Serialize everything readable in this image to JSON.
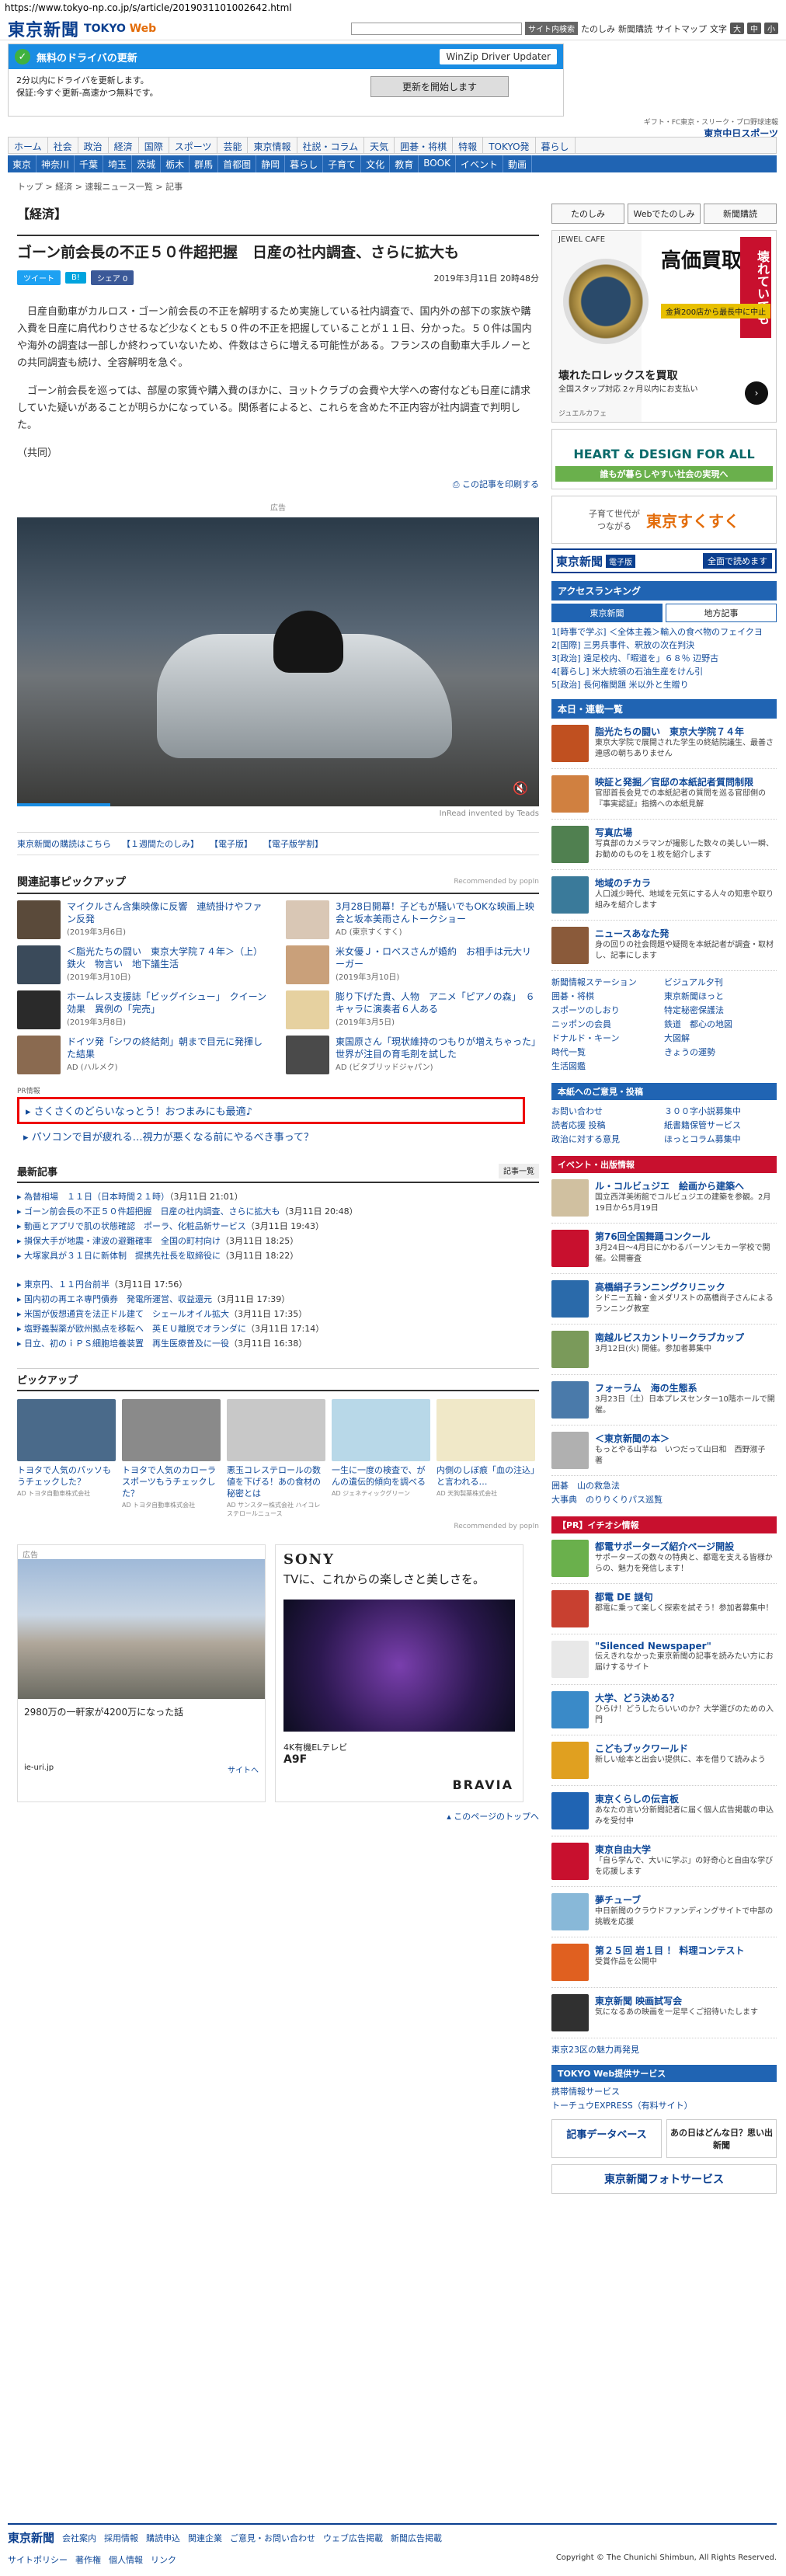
{
  "url": "https://www.tokyo-np.co.jp/s/article/2019031101002642.html",
  "header": {
    "logo": "東京新聞",
    "sub_left": "TOKYO ",
    "sub_right": "Web",
    "search_btn": "サイト内検索",
    "links": [
      "たのしみ",
      "新聞購読",
      "サイトマップ"
    ],
    "font_label": "文字",
    "font_btns": [
      "大",
      "中",
      "小"
    ]
  },
  "ad_top": {
    "title": "無料のドライバの更新",
    "winzip": "WinZip Driver Updater",
    "line1": "2分以内にドライバを更新します。",
    "line2": "保証:今すぐ更新-高速かつ無料です。",
    "button": "更新を開始します"
  },
  "rbanner": {
    "l1": "ギフト・FC東京・スリーク・プロ野球速報",
    "l2": "東京中日スポーツ"
  },
  "nav1": [
    "ホーム",
    "社会",
    "政治",
    "経済",
    "国際",
    "スポーツ",
    "芸能",
    "東京情報",
    "社説・コラム",
    "天気",
    "囲碁・将棋",
    "特報",
    "TOKYO発",
    "暮らし"
  ],
  "nav2": [
    "東京",
    "神奈川",
    "千葉",
    "埼玉",
    "茨城",
    "栃木",
    "群馬",
    "首都圏",
    "静岡",
    "暮らし",
    "子育て",
    "文化",
    "教育",
    "BOOK",
    "イベント",
    "動画"
  ],
  "breadcrumb": "トップ > 経済 > 速報ニュース一覧 > 記事",
  "article": {
    "section": "【経済】",
    "title": "ゴーン前会長の不正５０件超把握　日産の社内調査、さらに拡大も",
    "share": [
      "ツイート",
      "B!",
      "シェア 0"
    ],
    "date": "2019年3月11日 20時48分",
    "p1": "日産自動車がカルロス・ゴーン前会長の不正を解明するため実施している社内調査で、国内外の部下の家族や購入費を日産に肩代わりさせるなど少なくとも５０件の不正を把握していることが１１日、分かった。５０件は国内や海外の調査は一部しか終わっていないため、件数はさらに増える可能性がある。フランスの自動車大手ルノーとの共同調査も続け、全容解明を急ぐ。",
    "p2": "ゴーン前会長を巡っては、部屋の家賃や購入費のほかに、ヨットクラブの会費や大学への寄付なども日産に請求していた疑いがあることが明らかになっている。関係者によると、これらを含めた不正内容が社内調査で判明した。",
    "credit": "（共同）",
    "print": "この記事を印刷する"
  },
  "ad_video": {
    "label": "広告",
    "inread": "InRead invented by Teads"
  },
  "links_row": [
    "東京新聞の購読はこちら",
    "【１週間たのしみ】",
    "【電子版】",
    "【電子版学割】"
  ],
  "related": {
    "title": "関連記事ピックアップ",
    "rec": "Recommended by popIn",
    "items": [
      {
        "t": "マイクルさん含集映像に反響　連続掛けやファン反発",
        "s": "(2019年3月6日)"
      },
      {
        "t": "3月28日開幕！子どもが騒いでもOKな映画上映会と坂本美雨さんトークショー",
        "s": "AD (東京すくすく)"
      },
      {
        "t": "＜脂光たちの闘い　東京大学院７４年＞（上）鉄火　物言い　地下議生活",
        "s": "(2019年3月10日)"
      },
      {
        "t": "米女優Ｊ・ロペスさんが婚約　お相手は元大リーガー",
        "s": "(2019年3月10日)"
      },
      {
        "t": "ホームレス支援誌「ビッグイシュー」　クイーン効果　異例の「完売」",
        "s": "(2019年3月8日)"
      },
      {
        "t": "膨り下げた貴、人物　アニメ「ピアノの森」　６キャラに演奏者６人ある",
        "s": "(2019年3月5日)"
      },
      {
        "t": "ドイツ発「シワの終結剤」朝まで目元に発揮した結果",
        "s": "AD (ハルメク)"
      },
      {
        "t": "東国原さん「現状維持のつもりが増えちゃった」世界が注目の育毛剤を試した",
        "s": "AD (ビタブリッドジャパン)"
      }
    ]
  },
  "pr": {
    "label": "PR情報",
    "l1": "さくさくのどらいなっとう！おつまみにも最適♪",
    "l2": "パソコンで目が疲れる…視力が悪くなる前にやるべき事って？"
  },
  "latest": {
    "title": "最新記事",
    "more": "記事一覧",
    "g1": [
      {
        "t": "為替相場　１１日（日本時間２１時）",
        "d": "（3月11日 21:01）"
      },
      {
        "t": "ゴーン前会長の不正５０件超把握　日産の社内調査、さらに拡大も",
        "d": "（3月11日 20:48）"
      },
      {
        "t": "動画とアプリで肌の状態確認　ポーラ、化粧品新サービス",
        "d": "（3月11日 19:43）"
      },
      {
        "t": "損保大手が地震・津波の避難確率　全国の町村向け",
        "d": "（3月11日 18:25）"
      },
      {
        "t": "大塚家具が３１日に新体制　提携先社長を取締役に",
        "d": "（3月11日 18:22）"
      }
    ],
    "g2": [
      {
        "t": "東京円、１１円台前半",
        "d": "（3月11日 17:56）"
      },
      {
        "t": "国内初の再エネ専門債券　発電所運営、収益還元",
        "d": "（3月11日 17:39）"
      },
      {
        "t": "米国が仮想通貨を法正ドル建て　シェールオイル拡大",
        "d": "（3月11日 17:35）"
      },
      {
        "t": "塩野義製薬が欧州拠点を移転へ　英ＥＵ離脱でオランダに",
        "d": "（3月11日 17:14）"
      },
      {
        "t": "日立、初のｉＰＳ細胞培養装置　再生医療普及に一役",
        "d": "（3月11日 16:38）"
      }
    ]
  },
  "pickup": {
    "title": "ピックアップ",
    "rec": "Recommended by popIn",
    "items": [
      {
        "t": "トヨタで人気のパッソもうチェックした？",
        "s": "AD トヨタ自動車株式会社"
      },
      {
        "t": "トヨタで人気のカローラスポーツもうチェックした？",
        "s": "AD トヨタ自動車株式会社"
      },
      {
        "t": "悪玉コレステロールの数値を下げる！あの食材の秘密とは",
        "s": "AD サンスター株式会社 ハイコレステロールニュース"
      },
      {
        "t": "一生に一度の検査で、がんの遺伝的傾向を調べる",
        "s": "AD ジェネティックグリーン"
      },
      {
        "t": "内側のしぼ痕「血の注込」と言われる…",
        "s": "AD 天狗製薬株式会社"
      }
    ]
  },
  "ad_cards": {
    "label": "広告",
    "house_caption": "2980万の一軒家が4200万になった話",
    "house_src": "ie-uri.jp",
    "house_more": "サイトへ",
    "sony_brand": "SONY",
    "sony_slogan": "TVに、これからの楽しさと美しさを。",
    "sony_model": "4K有機ELテレビ",
    "sony_model2": "A9F",
    "sony_brv": "BRAVIA"
  },
  "totop": "このページのトップへ",
  "side": {
    "btns": [
      "たのしみ",
      "Webでたのしみ",
      "新聞購読"
    ],
    "watch": {
      "brand": "JEWEL CAFE",
      "kt": "高価買取",
      "red": "壊れていても",
      "gold": "金貨200店から最長中に中止",
      "bt": "壊れたロレックスを買取",
      "bs": "全国スタップ対応 2ヶ月以内にお支払い",
      "small": "ジュエルカフェ"
    },
    "hd": {
      "t": "HEART & DESIGN FOR ALL",
      "s": "誰もが暮らしやすい社会の実現へ"
    },
    "kosodate": {
      "small1": "子育て世代が",
      "small2": "つながる",
      "big": "東京すくすく"
    },
    "tkd": {
      "logo": "東京新聞",
      "e": "電子版",
      "t": "全面で読めます"
    },
    "ranking": {
      "title": "アクセスランキング",
      "tabs": [
        "東京新聞",
        "地方記事"
      ],
      "items": [
        "1[時事で学ぶ] ＜全体主義＞輸入の食べ物のフェイクヨ",
        "2[国際] 三男兵事件、釈放の次在判決",
        "3[政治] 遠足校内、「暇道を」６８％ 辺野古",
        "4[暮らし] 米大統領の石油生産をけん引",
        "5[政治] 長何権関題 米以外と生贈り"
      ]
    },
    "news": {
      "title": "本日・連載一覧",
      "items": [
        {
          "t": "脂光たちの闘い　東京大学院７４年",
          "d": "東京大学院で展開された学生の終結院議生、最善さ連感の朝ちありません"
        },
        {
          "t": "映証と発掘／官邸の本紙記者質問制限",
          "d": "官邸首長会見での本紙記者の質問を巡る官邸側の『事実認証』指摘への本紙見解"
        },
        {
          "t": "写真広場",
          "d": "写真部のカメラマンが撮影した数々の美しい一瞬、お勧めのものを１枚を紹介します"
        },
        {
          "t": "地域のチカラ",
          "d": "人口減少時代、地域を元気にする人々の知恵や取り組みを紹介します"
        },
        {
          "t": "ニュースあなた発",
          "d": "身の回りの社会問題や疑問を本紙記者が調査・取材し、記事にします"
        }
      ]
    },
    "grid": [
      "新聞情報ステーション",
      "ビジュアル夕刊",
      "囲碁・将棋",
      "東京新聞ほっと",
      "スポーツのしおり",
      "特定秘密保護法",
      "ニッポンの会員",
      "鉄道　都心の地図",
      "ドナルド・キーン",
      "大図解",
      "時代一覧",
      "きょうの運勢",
      "生活図鑑"
    ],
    "help": {
      "title": "本紙へのご意見・投稿",
      "items": [
        "お問い合わせ",
        "３００字小説募集中",
        "読者応援 投稿",
        "紙書籍保管サービス",
        "政治に対する意見",
        "ほっとコラム募集中"
      ]
    },
    "events": {
      "title": "イベント・出版情報",
      "items": [
        {
          "t": "ル・コルビュジエ　絵画から建築へ",
          "d": "国立西洋美術館でコルビュジエの建築を参観。2月19日から5月19日"
        },
        {
          "t": "第76回全国舞踊コンクール",
          "d": "3月24日～4月日にかわるバーソンモカー学校で開催。公開審査"
        },
        {
          "t": "高橋絹子ランニングクリニック",
          "d": "シドニー五輪・金メダリストの高橋尚子さんによるランニング教室"
        },
        {
          "t": "南越ルビスカントリークラブカップ",
          "d": "3月12日(火) 開催。参加者募集中"
        },
        {
          "t": "フォーラム　海の生態系",
          "d": "3月23日（土）日本プレスセンター10階ホールで開催。"
        },
        {
          "t": "＜東京新聞の本＞",
          "d": "もっとやる山芋ね　いつだって山日和　西野淑子　著"
        }
      ],
      "g1": "囲碁　山の救急法",
      "g2": "大事典　のりりくりパス巡覧"
    },
    "pr": {
      "title": "【PR】イチオシ情報",
      "items": [
        {
          "t": "都電サポーターズ紹介ページ開設",
          "d": "サポーターズの数々の特典と、都電を支える皆様からの、魅力を発信します！"
        },
        {
          "t": "都電 DE 謎旬",
          "d": "都電に乗って楽しく探索を試そう！参加者募集中！"
        },
        {
          "t": "\"Silenced Newspaper\"",
          "d": "伝えきれなかった東京新聞の記事を読みたい方にお届けするサイト"
        },
        {
          "t": "大学、どう決める？",
          "d": "ひらけ！どうしたらいいのか？大学選びのための入門"
        },
        {
          "t": "こどもブックワールド",
          "d": "新しい絵本と出会い提供に、本を借りて読みよう"
        },
        {
          "t": "東京くらしの伝言板",
          "d": "あなたの言い分新聞記者に届く個人広告掲載の申込みを受付中"
        },
        {
          "t": "東京自由大学",
          "d": "「自ら学んで、大いに学ぶ」の好奇心と自由な学びを応援します"
        },
        {
          "t": "夢チューブ",
          "d": "中日新聞のクラウドファンディングサイトで中部の挑戦を応援"
        },
        {
          "t": "第２５回 岩１目 ！ 料理コンテスト",
          "d": "受賞作品を公開中"
        },
        {
          "t": "東京新聞 映画試写会",
          "d": "気になるあの映画を一足早くご招待いたします"
        }
      ],
      "extra": "東京23区の魅力再発見"
    },
    "svc": {
      "title": "TOKYO Web提供サービス",
      "items": [
        "携帯情報サービス",
        "トーチュウEXPRESS（有料サイト）"
      ]
    },
    "db": {
      "b1": "記事データベース",
      "b2": "あの日はどんな日？思い出新聞"
    },
    "photo": "東京新聞フォトサービス"
  },
  "footer": {
    "logo": "東京新聞",
    "r1": [
      "会社案内",
      "採用情報",
      "購読申込",
      "関連企業",
      "ご意見・お問い合わせ",
      "ウェブ広告掲載",
      "新聞広告掲載"
    ],
    "r2": [
      "サイトポリシー",
      "著作権",
      "個人情報",
      "リンク"
    ],
    "copyright": "Copyright © The Chunichi Shimbun, All Rights Reserved."
  }
}
